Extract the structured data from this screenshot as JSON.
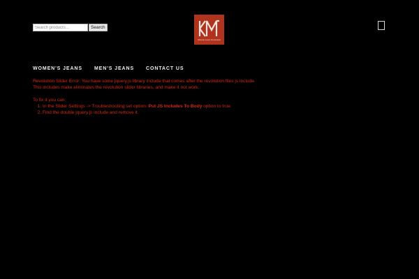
{
  "search": {
    "placeholder": "Search products…",
    "button_label": "Search"
  },
  "logo": {
    "tagline": "Ultimate Jeans Destination"
  },
  "nav": {
    "items": [
      "WOMEN'S JEANS",
      "MEN'S JEANS",
      "CONTACT US"
    ]
  },
  "error": {
    "line1": "Revolution Slider Error: You have some jquery.js library include that comes after the revolution files js include.",
    "line2": "This includes make eliminates the revolution slider libraries, and make it not work.",
    "fix_intro": "To fix it you can:",
    "step1_prefix": "In the Slider Settings -> Troubleshooting set option:",
    "step1_bold": "Put JS Includes To Body",
    "step1_suffix": "option to true.",
    "step2": "Find the double jquery.js include and remove it."
  },
  "colors": {
    "background": "#000000",
    "error_text": "#d32717",
    "logo_bg": "#b0331d",
    "nav_text": "#eeeeee"
  },
  "icons": [
    "logo-mark",
    "cart-icon"
  ]
}
